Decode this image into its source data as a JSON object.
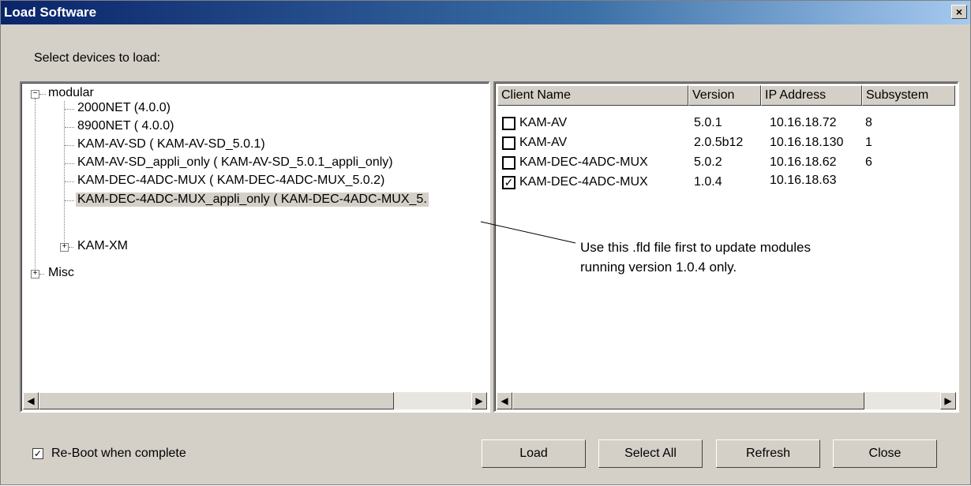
{
  "window": {
    "title": "Load Software",
    "close_glyph": "×"
  },
  "prompt": "Select devices to load:",
  "tree": {
    "root": "modular",
    "children": [
      "2000NET (4.0.0)",
      "8900NET ( 4.0.0)",
      "KAM-AV-SD  ( KAM-AV-SD_5.0.1)",
      "KAM-AV-SD_appli_only  ( KAM-AV-SD_5.0.1_appli_only)",
      "KAM-DEC-4ADC-MUX  ( KAM-DEC-4ADC-MUX_5.0.2)",
      "KAM-DEC-4ADC-MUX_appli_only  ( KAM-DEC-4ADC-MUX_5."
    ],
    "subgroup": "KAM-XM",
    "misc": "Misc",
    "expand_minus": "−",
    "expand_plus": "+"
  },
  "list": {
    "headers": [
      "Client Name",
      "Version",
      "IP Address",
      "Subsystem"
    ],
    "rows": [
      {
        "name": "KAM-AV",
        "version": "5.0.1",
        "ip": "10.16.18.72",
        "subsystem": "8",
        "checked": false
      },
      {
        "name": "KAM-AV",
        "version": "2.0.5b12",
        "ip": "10.16.18.130",
        "subsystem": "1",
        "checked": false
      },
      {
        "name": "KAM-DEC-4ADC-MUX",
        "version": "5.0.2",
        "ip": "10.16.18.62",
        "subsystem": "6",
        "checked": false
      },
      {
        "name": "KAM-DEC-4ADC-MUX",
        "version": "1.0.4",
        "ip": "10.16.18.63",
        "subsystem": "",
        "checked": true
      }
    ],
    "check_glyph": "✓"
  },
  "callout": {
    "line1": "Use this .fld file first to update modules",
    "line2": "running version 1.0.4 only."
  },
  "scroll": {
    "left_arrow": "◀",
    "right_arrow": "▶"
  },
  "footer": {
    "reboot_label": "Re-Boot when complete",
    "reboot_checked": true,
    "buttons": {
      "load": "Load",
      "select_all": "Select All",
      "refresh": "Refresh",
      "close": "Close"
    }
  }
}
